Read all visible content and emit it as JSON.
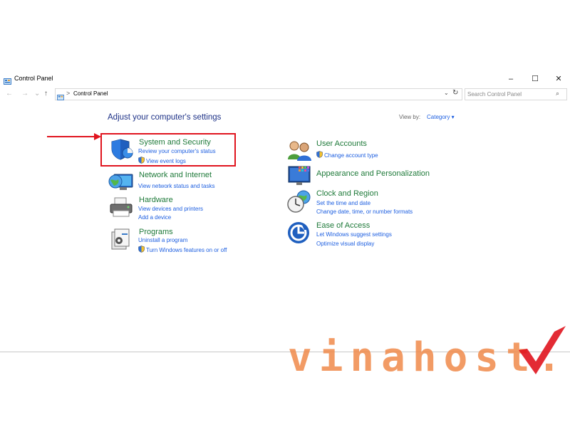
{
  "window": {
    "title": "Control Panel",
    "minimize_glyph": "–",
    "maximize_glyph": "☐",
    "close_glyph": "✕"
  },
  "nav": {
    "back_glyph": "←",
    "forward_glyph": "→",
    "recent_glyph": "⌄",
    "up_glyph": "↑",
    "address_separator": ">",
    "address_text": "Control Panel",
    "dropdown_glyph": "⌄",
    "refresh_glyph": "↻",
    "search_placeholder": "Search Control Panel",
    "search_glyph": "⌕"
  },
  "main": {
    "heading": "Adjust your computer's settings",
    "view_by_label": "View by:",
    "view_by_value": "Category ▾"
  },
  "categories_left": [
    {
      "title": "System and Security",
      "icon": "shield-icon",
      "links": [
        "Review your computer's status",
        "View event logs"
      ]
    },
    {
      "title": "Network and Internet",
      "icon": "globe-monitor-icon",
      "links": [
        "View network status and tasks"
      ]
    },
    {
      "title": "Hardware",
      "icon": "printer-icon",
      "links": [
        "View devices and printers",
        "Add a device"
      ]
    },
    {
      "title": "Programs",
      "icon": "programs-icon",
      "links": [
        "Uninstall a program",
        "Turn Windows features on or off"
      ]
    }
  ],
  "categories_right": [
    {
      "title": "User Accounts",
      "icon": "users-icon",
      "links": [
        "Change account type"
      ]
    },
    {
      "title": "Appearance and Personalization",
      "icon": "monitor-icon",
      "links": []
    },
    {
      "title": "Clock and Region",
      "icon": "clock-globe-icon",
      "links": [
        "Set the time and date",
        "Change date, time, or number formats"
      ]
    },
    {
      "title": "Ease of Access",
      "icon": "ease-of-access-icon",
      "links": [
        "Let Windows suggest settings",
        "Optimize visual display"
      ]
    }
  ],
  "watermark": {
    "text": "vinahost."
  },
  "colors": {
    "category_title": "#1f7a3a",
    "link": "#1c5ee0",
    "heading": "#1e3287",
    "highlight_border": "#e0141e",
    "watermark": "#f08a4b"
  }
}
